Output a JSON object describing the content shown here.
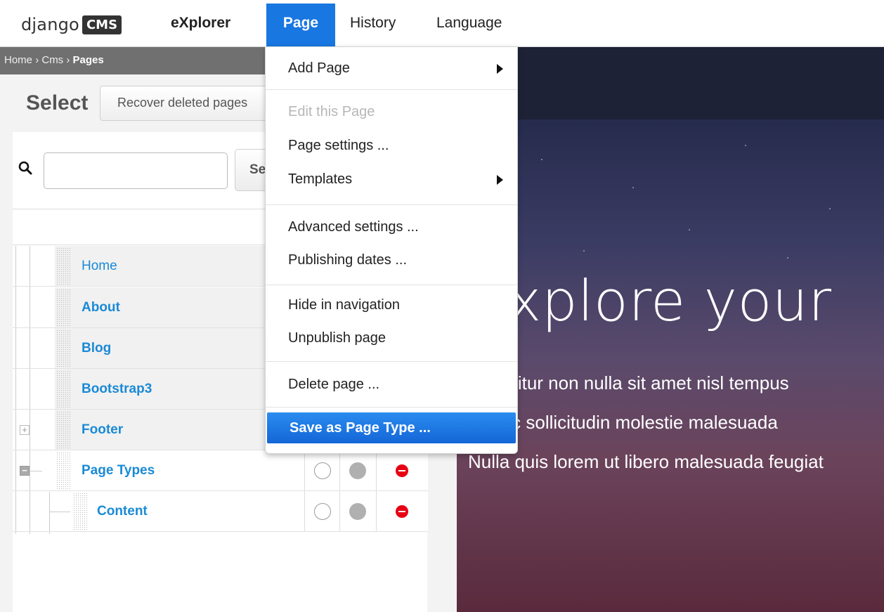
{
  "toolbar": {
    "logo_django": "django",
    "logo_cms": "CMS",
    "items": [
      "eXplorer",
      "Page",
      "History",
      "Language"
    ]
  },
  "breadcrumb": {
    "home": "Home",
    "sep": "›",
    "cms": "Cms",
    "pages": "Pages"
  },
  "admin": {
    "title": "Select",
    "recover_button": "Recover deleted pages",
    "search_placeholder": "",
    "search_button": "Search"
  },
  "tree": {
    "rows": [
      {
        "label": "Home",
        "bold": false,
        "expander": ""
      },
      {
        "label": "About",
        "bold": true,
        "expander": ""
      },
      {
        "label": "Blog",
        "bold": true,
        "expander": ""
      },
      {
        "label": "Bootstrap3",
        "bold": true,
        "expander": ""
      },
      {
        "label": "Footer",
        "bold": true,
        "expander": "+"
      },
      {
        "label": "Page Types",
        "bold": true,
        "expander": "−"
      },
      {
        "label": "Content",
        "bold": true,
        "expander": ""
      }
    ]
  },
  "preview": {
    "title": "Explore your",
    "lines": [
      "Curabitur non nulla sit amet nisl tempus",
      "Donec sollicitudin molestie malesuada",
      "Nulla quis lorem ut libero malesuada feugiat"
    ]
  },
  "menu": {
    "add_page": "Add Page",
    "edit_page": "Edit this Page",
    "page_settings": "Page settings ...",
    "templates": "Templates",
    "advanced_settings": "Advanced settings ...",
    "publishing_dates": "Publishing dates ...",
    "hide_navigation": "Hide in navigation",
    "unpublish": "Unpublish page",
    "delete_page": "Delete page ...",
    "save_page_type": "Save as Page Type ..."
  },
  "colors": {
    "accent": "#1877e0",
    "link": "#1a8ad6",
    "danger": "#e60012"
  }
}
